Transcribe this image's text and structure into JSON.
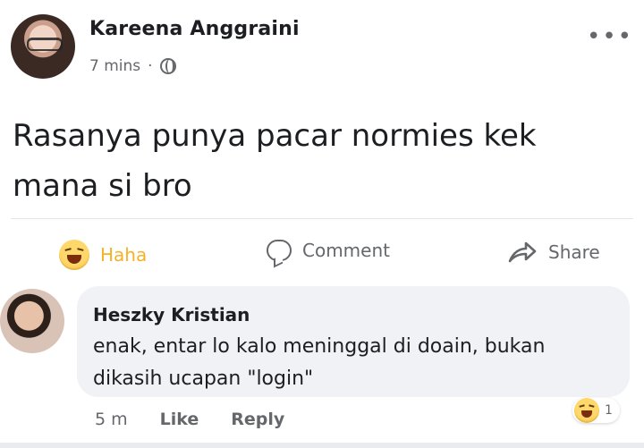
{
  "post": {
    "author_name": "Kareena Anggraini",
    "timestamp": "7 mins",
    "meta_separator": "·",
    "privacy_icon": "globe-icon",
    "more_icon": "more-options-icon",
    "text_line1": "Rasanya punya pacar normies kek",
    "text_line2": "mana si bro"
  },
  "actions": {
    "reaction_label": "Haha",
    "comment_label": "Comment",
    "share_label": "Share",
    "reaction_color": "#f7b125"
  },
  "comment": {
    "author_name": "Heszky Kristian",
    "text_line1": "enak, entar lo kalo meninggal di doain, bukan",
    "text_line2": "dikasih ucapan \"login\"",
    "time": "5 m",
    "like_label": "Like",
    "reply_label": "Reply",
    "reaction_count": "1",
    "reaction_icon": "haha-emoji-icon"
  },
  "colors": {
    "text_primary": "#1c1e21",
    "text_secondary": "#65676b",
    "bubble_bg": "#f0f2f5"
  }
}
